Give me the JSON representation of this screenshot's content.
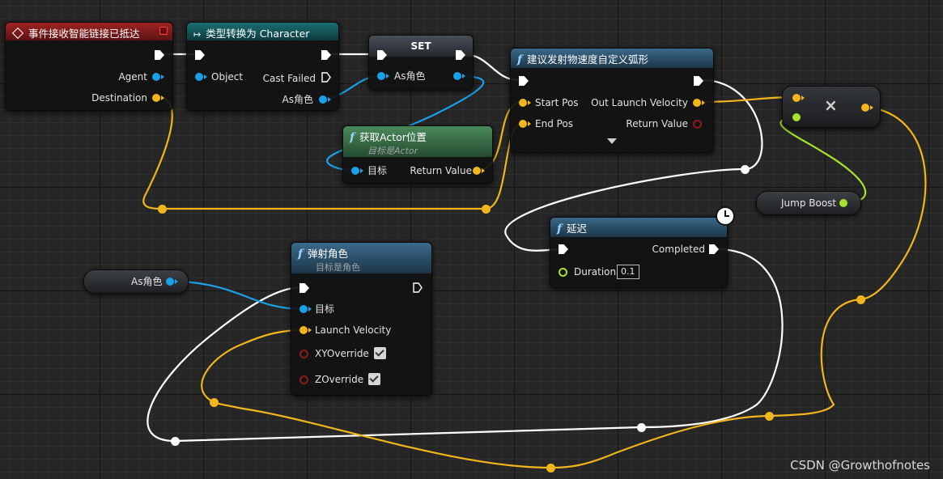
{
  "colors": {
    "event_header": "#8d1c1c",
    "cast_header": "#13595e",
    "pure_header": "#3a6e48",
    "func_header": "#25445c",
    "exec_wire": "#ffffff",
    "object_wire": "#1aa0e6",
    "vector_wire": "#f2b51c",
    "float_wire": "#a6e22e"
  },
  "nodes": {
    "event": {
      "title": "事件接收智能链接已抵达",
      "pins": {
        "agent": "Agent",
        "destination": "Destination"
      }
    },
    "cast": {
      "title": "类型转换为 Character",
      "pins": {
        "object": "Object",
        "cast_failed": "Cast Failed",
        "as_char": "As角色"
      }
    },
    "set": {
      "title": "SET",
      "pins": {
        "as_char": "As角色"
      }
    },
    "get_actor_location": {
      "title": "获取Actor位置",
      "subtitle": "目标是Actor",
      "pins": {
        "target": "目标",
        "return_value": "Return Value"
      }
    },
    "suggest_arc": {
      "title": "建议发射物速度自定义弧形",
      "pins": {
        "start_pos": "Start Pos",
        "end_pos": "End Pos",
        "out_velocity": "Out Launch Velocity",
        "return_value": "Return Value"
      }
    },
    "multiply": {
      "symbol": "×"
    },
    "jump_boost": {
      "label": "Jump Boost"
    },
    "delay": {
      "title": "延迟",
      "pins": {
        "completed": "Completed",
        "duration": "Duration",
        "duration_value": "0.1"
      }
    },
    "as_char_var": {
      "label": "As角色"
    },
    "launch": {
      "title": "弹射角色",
      "subtitle": "目标是角色",
      "pins": {
        "target": "目标",
        "velocity": "Launch Velocity",
        "xy": "XYOverride",
        "z": "ZOverride"
      },
      "xy_checked": true,
      "z_checked": true
    }
  },
  "icons": {
    "event": "event-diamond-icon",
    "cast": "cast-arrow-icon",
    "function": "function-f-icon",
    "delay": "clock-icon",
    "expand": "chevron-down-icon"
  },
  "watermark": "CSDN @Growthofnotes"
}
